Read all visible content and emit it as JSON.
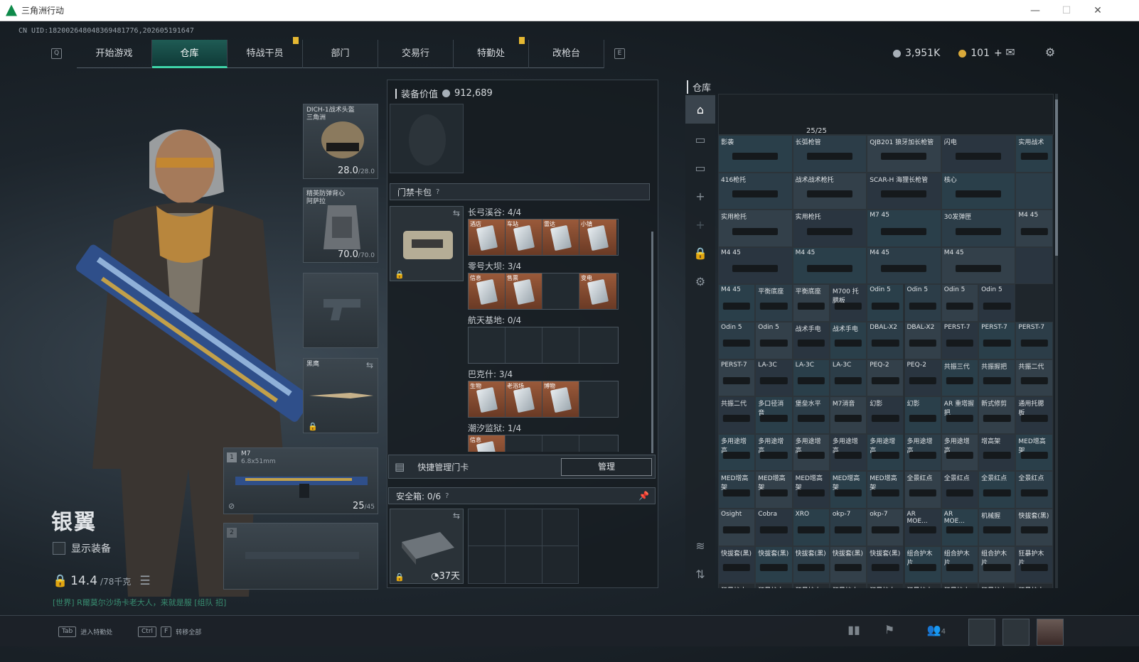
{
  "window": {
    "title": "三角洲行动",
    "minimize": "—",
    "maximize": "☐",
    "close": "✕"
  },
  "uid": "CN UID:18200264804836948177​6,202605191647",
  "nav": {
    "left_key": "Q",
    "right_key": "E",
    "tabs": [
      "开始游戏",
      "仓库",
      "特战干员",
      "部门",
      "交易行",
      "特勤处",
      "改枪台"
    ],
    "active_tab": "仓库"
  },
  "currency": {
    "silver": "3,951K",
    "gold": "101",
    "add": "+"
  },
  "character": {
    "name": "银翼",
    "show_equipment": "显示装备",
    "weight": "14.4",
    "weight_max": "/78千克",
    "chat": "[世界] R爾莫尔沙场卡老大人，来就是服 [组队 招]"
  },
  "slots": {
    "helmet": {
      "label": "DICH-1战术头盔",
      "sub": "三角洲",
      "dur": "28.0",
      "max": "/28.0"
    },
    "armor": {
      "label": "精英防弹背心",
      "sub": "阿萨拉",
      "dur": "70.0",
      "max": "/70.0"
    },
    "melee": {
      "label": "黑鹰"
    },
    "primary1": {
      "index": "1",
      "name": "M7",
      "ammo_type": "6.8x51mm",
      "ammo": "25",
      "ammo_max": "/45"
    },
    "primary2": {
      "index": "2"
    }
  },
  "midpanel": {
    "equipment_value_label": "装备价值",
    "equipment_value": "912,689",
    "keycard_title": "门禁卡包",
    "groups": [
      {
        "title": "长弓溪谷: 4/4",
        "cards": [
          "酒店",
          "车站",
          "雷达",
          "小镇"
        ]
      },
      {
        "title": "零号大坝: 3/4",
        "cards": [
          "信息",
          "售票",
          "",
          "变电"
        ]
      },
      {
        "title": "航天基地: 0/4",
        "cards": [
          "",
          "",
          "",
          ""
        ]
      },
      {
        "title": "巴克什: 3/4",
        "cards": [
          "生物",
          "老浴场",
          "博物",
          ""
        ]
      },
      {
        "title": "潮汐监狱: 1/4",
        "cards": [
          "信息"
        ]
      }
    ],
    "quick_manage": "快捷管理门卡",
    "manage_btn": "管理",
    "safebox_title": "安全箱: 0/6",
    "safebox_days": "37天"
  },
  "warehouse": {
    "title": "仓库",
    "capacity": "25/25",
    "items": [
      [
        "影袭",
        "长弧枪管",
        "QJB201 狼牙加长枪管",
        "闪电",
        "实用战术"
      ],
      [
        "416枪托",
        "战术战术枪托",
        "SCAR-H 海狸长枪管",
        "核心",
        ""
      ],
      [
        "实用枪托",
        "实用枪托",
        "M7 45",
        "30发弹匣",
        "M4 45"
      ],
      [
        "M4 45",
        "M4 45",
        "M4 45",
        "M4 45",
        ""
      ],
      [
        "M4 45",
        "平衡底座",
        "平衡底座",
        "M700 托腮板",
        "Odin 5",
        "Odin 5",
        "Odin 5",
        "Odin 5"
      ],
      [
        "Odin 5",
        "Odin 5",
        "战术手电",
        "战术手电",
        "DBAL-X2",
        "DBAL-X2",
        "PERST-7",
        "PERST-7",
        "PERST-7"
      ],
      [
        "PERST-7",
        "LA-3C",
        "LA-3C",
        "LA-3C",
        "PEQ-2",
        "PEQ-2",
        "共振三代",
        "共振握把",
        "共振二代"
      ],
      [
        "共振二代",
        "多口径消音",
        "堡垒水平",
        "M7消音",
        "幻影",
        "幻影",
        "AR 重塔握把",
        "新式修剪",
        "通用托腮板"
      ],
      [
        "多用途增高",
        "多用途增高",
        "多用途增高",
        "多用途增高",
        "多用途增高",
        "多用途增高",
        "多用途增高",
        "增高架",
        "MED增高架"
      ],
      [
        "MED增高架",
        "MED增高架",
        "MED增高架",
        "MED增高架",
        "MED增高架",
        "全景红点",
        "全景红点",
        "全景红点",
        "全景红点"
      ],
      [
        "Osight",
        "Cobra",
        "XRO",
        "okp-7",
        "okp-7",
        "AR MOE...",
        "AR MOE...",
        "机械握",
        "快拔套(黑)"
      ],
      [
        "快拔套(黑)",
        "快拔套(黑)",
        "快拔套(黑)",
        "快拔套(黑)",
        "快拔套(黑)",
        "组合护木片",
        "组合护木片",
        "组合护木片",
        "狂暴护木片"
      ],
      [
        "狂暴护木片",
        "狂暴护木片",
        "狂暴护木片",
        "狂暴护木片",
        "狂暴护木片",
        "狂暴护木片",
        "狂暴护木片",
        "狂暴护木片",
        "狂暴护木片"
      ]
    ]
  },
  "bottom": {
    "tab_key": "Tab",
    "tab_label": "进入特勤处",
    "ctrl_key": "Ctrl",
    "f_key": "F",
    "f_label": "转移全部",
    "friends": "4"
  },
  "colors": {
    "accent": "#3fd4a8",
    "tab_flag": "#e5b832"
  }
}
